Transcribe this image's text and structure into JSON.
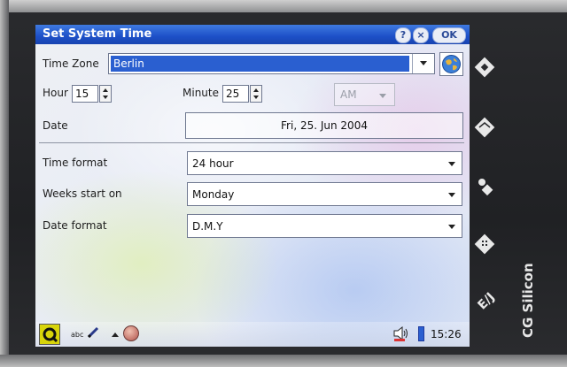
{
  "window": {
    "title": "Set System Time",
    "ok_label": "OK",
    "help_label": "?",
    "close_label": "×"
  },
  "time_zone": {
    "label": "Time Zone",
    "value": "Berlin"
  },
  "hour": {
    "label": "Hour",
    "value": "15"
  },
  "minute": {
    "label": "Minute",
    "value": "25"
  },
  "ampm": {
    "value": "AM",
    "enabled": false
  },
  "date": {
    "label": "Date",
    "value": "Fri, 25. Jun 2004"
  },
  "time_format": {
    "label": "Time format",
    "value": "24 hour"
  },
  "weeks_start": {
    "label": "Weeks start on",
    "value": "Monday"
  },
  "date_format": {
    "label": "Date format",
    "value": "D.M.Y"
  },
  "taskbar": {
    "input_mode": "abc",
    "clock": "15:26"
  },
  "device": {
    "brand": "CG Silicon"
  },
  "colors": {
    "titlebar": "#1d50c8",
    "selection": "#2a5fd0",
    "taskbar_start": "#d8d40a"
  },
  "icons": [
    "help-icon",
    "close-icon",
    "globe-icon",
    "home-icon",
    "mail-icon",
    "contacts-icon",
    "calculator-icon",
    "language-icon",
    "speaker-icon",
    "battery-icon",
    "pencil-icon"
  ]
}
